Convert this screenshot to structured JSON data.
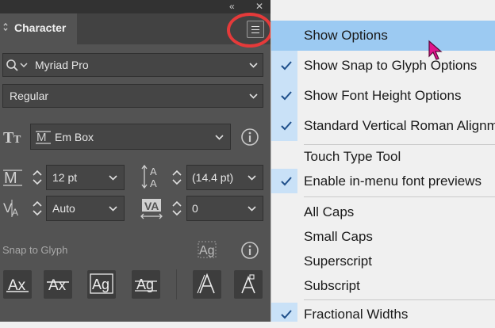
{
  "panel": {
    "tab_label": "Character",
    "font_family": "Myriad Pro",
    "font_style": "Regular",
    "em_box": "Em Box",
    "font_size": "12 pt",
    "leading": "(14.4 pt)",
    "kerning": "Auto",
    "tracking": "0",
    "snap_label": "Snap to Glyph"
  },
  "menu": {
    "items": [
      {
        "label": "Show Options",
        "checked": false,
        "highlighted": true
      },
      {
        "label": "Show Snap to Glyph Options",
        "checked": true
      },
      {
        "label": "Show Font Height Options",
        "checked": true
      },
      {
        "label": "Standard Vertical Roman Alignment",
        "checked": true
      },
      {
        "label": "Touch Type Tool",
        "checked": false
      },
      {
        "label": "Enable in-menu font previews",
        "checked": true
      },
      {
        "label": "All Caps",
        "checked": false
      },
      {
        "label": "Small Caps",
        "checked": false
      },
      {
        "label": "Superscript",
        "checked": false
      },
      {
        "label": "Subscript",
        "checked": false
      },
      {
        "label": "Fractional Widths",
        "checked": true
      }
    ]
  },
  "colors": {
    "panel_bg": "#535353",
    "menu_bg": "#f0f0f0",
    "highlight": "#9ccaf2",
    "annotation_circle": "#e53a3a",
    "cursor": "#e0148c"
  }
}
